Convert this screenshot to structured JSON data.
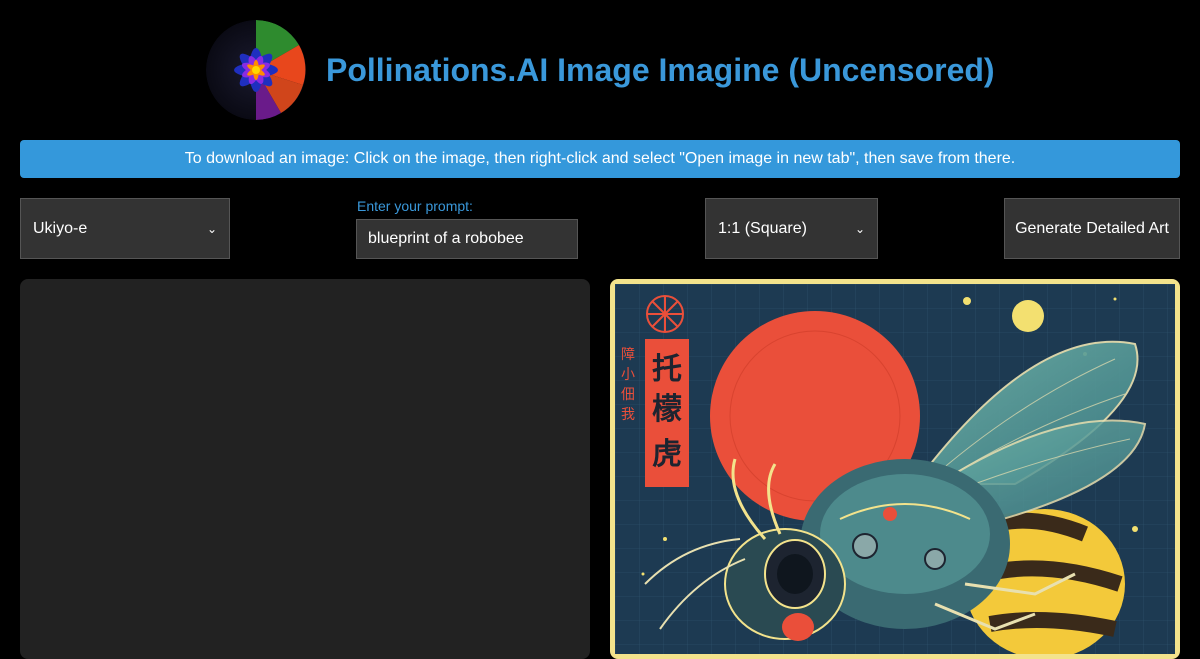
{
  "header": {
    "title": "Pollinations.AI Image Imagine (Uncensored)",
    "logo_icon": "lotus-flower-icon"
  },
  "banner": {
    "text": "To download an image: Click on the image, then right-click and select \"Open image in new tab\", then save from there."
  },
  "controls": {
    "style_select": {
      "value": "Ukiyo-e"
    },
    "prompt": {
      "label": "Enter your prompt:",
      "value": "blueprint of a robobee"
    },
    "ratio_select": {
      "value": "1:1 (Square)"
    },
    "generate_label": "Generate Detailed Art"
  },
  "colors": {
    "accent": "#3498db",
    "title": "#3a98da",
    "frame": "#f3e38c",
    "panel": "#222222"
  },
  "artwork": {
    "icon": "robot-bee-ukiyo-e-artwork",
    "kanji_large": [
      "托",
      "檬",
      "虎"
    ],
    "kanji_small": [
      "障",
      "小",
      "佃",
      "我"
    ]
  }
}
